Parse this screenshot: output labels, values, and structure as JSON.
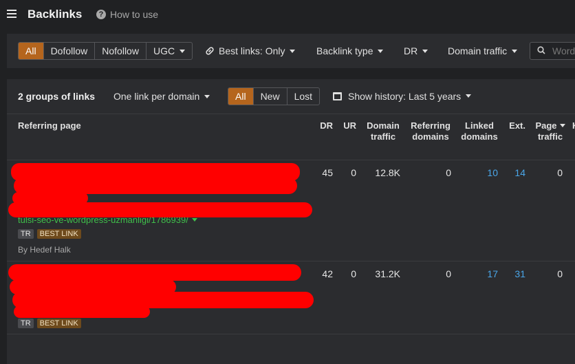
{
  "header": {
    "title": "Backlinks",
    "help_label": "How to use"
  },
  "filters": {
    "link_types": [
      "All",
      "Dofollow",
      "Nofollow",
      "UGC"
    ],
    "best_links": "Best links: Only",
    "backlink_type": "Backlink type",
    "dr": "DR",
    "domain_traffic": "Domain traffic",
    "search_placeholder": "Word"
  },
  "table_controls": {
    "groups": "2 groups of links",
    "grouping": "One link per domain",
    "status_tabs": [
      "All",
      "New",
      "Lost"
    ],
    "history": "Show history: Last 5 years"
  },
  "columns": {
    "referring_page": "Referring page",
    "dr": "DR",
    "ur": "UR",
    "domain_traffic": [
      "Domain",
      "traffic"
    ],
    "referring_domains": [
      "Referring",
      "domains"
    ],
    "linked_domains": [
      "Linked",
      "domains"
    ],
    "ext": "Ext.",
    "page_traffic": [
      "Page",
      "traffic"
    ],
    "next": "K"
  },
  "rows": [
    {
      "url_fragment": "tulsi-seo-ve-wordpress-uzmanligi/1786939/",
      "tags": [
        "TR",
        "BEST LINK"
      ],
      "author": "By Hedef Halk",
      "dr": "45",
      "ur": "0",
      "domain_traffic": "12.8K",
      "referring_domains": "0",
      "linked_domains": "10",
      "ext": "14",
      "page_traffic": "0"
    },
    {
      "tags": [
        "TR",
        "BEST LINK"
      ],
      "dr": "42",
      "ur": "0",
      "domain_traffic": "31.2K",
      "referring_domains": "0",
      "linked_domains": "17",
      "ext": "31",
      "page_traffic": "0"
    }
  ],
  "colors": {
    "accent": "#b5651d",
    "link_green": "#3fbf4a",
    "metric_blue": "#4aa6e8",
    "redaction": "#ff0000"
  }
}
